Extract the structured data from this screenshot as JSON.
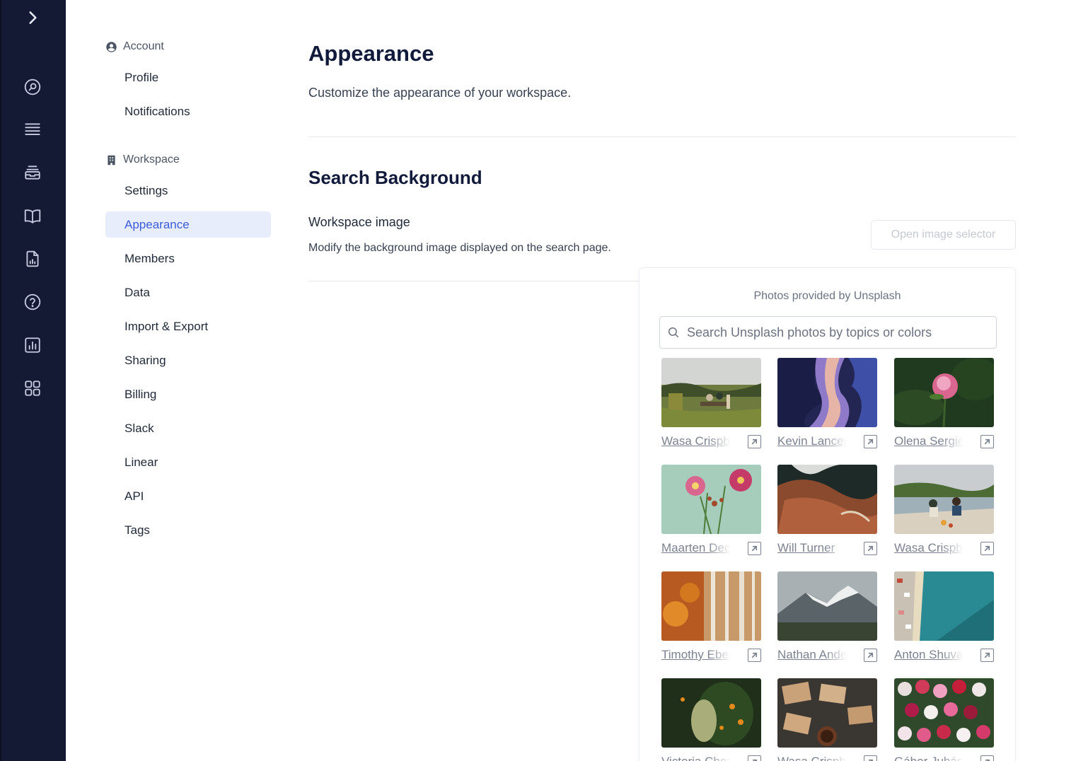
{
  "rail": {
    "icons": [
      "chevron-right-icon",
      "search-icon",
      "list-icon",
      "inbox-icon",
      "book-icon",
      "report-icon",
      "help-icon",
      "analytics-icon",
      "apps-icon"
    ]
  },
  "nav": {
    "account_label": "Account",
    "account_items": [
      "Profile",
      "Notifications"
    ],
    "workspace_label": "Workspace",
    "workspace_items": [
      "Settings",
      "Appearance",
      "Members",
      "Data",
      "Import & Export",
      "Sharing",
      "Billing",
      "Slack",
      "Linear",
      "API",
      "Tags"
    ],
    "active_item": "Appearance"
  },
  "page": {
    "title": "Appearance",
    "subtitle": "Customize the appearance of your workspace.",
    "section_title": "Search Background",
    "field_label": "Workspace image",
    "field_hint": "Modify the background image displayed on the search page.",
    "open_selector_button": "Open image selector"
  },
  "selector": {
    "caption": "Photos provided by Unsplash",
    "search_placeholder": "Search Unsplash photos by topics or colors",
    "search_value": "",
    "photos": [
      {
        "credit": "Wasa Crispbread",
        "scene": "picnic-field"
      },
      {
        "credit": "Kevin Lanceplaine",
        "scene": "canyon"
      },
      {
        "credit": "Olena Sergienko",
        "scene": "peony"
      },
      {
        "credit": "Maarten Deckers",
        "scene": "flowers-vase"
      },
      {
        "credit": "Will Turner",
        "scene": "rocks-aerial"
      },
      {
        "credit": "Wasa Crispbread",
        "scene": "lake-picnic"
      },
      {
        "credit": "Timothy Eberly",
        "scene": "autumn-forest"
      },
      {
        "credit": "Nathan Anderson",
        "scene": "mountains"
      },
      {
        "credit": "Anton Shuvalov",
        "scene": "beach-aerial"
      },
      {
        "credit": "Victoria Chen",
        "scene": "orange-tree"
      },
      {
        "credit": "Wasa Crispbread",
        "scene": "snacks"
      },
      {
        "credit": "Gábor Juhász",
        "scene": "tulips"
      }
    ]
  }
}
